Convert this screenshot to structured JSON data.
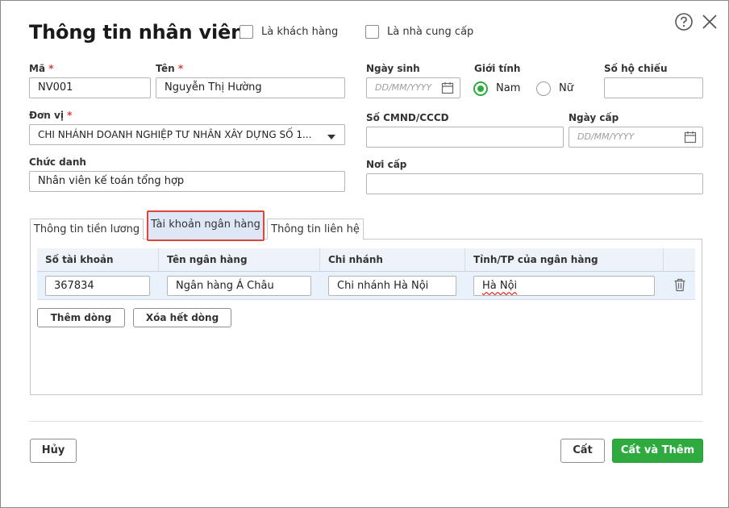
{
  "title": "Thông tin nhân viên",
  "flags": {
    "customer_label": "Là khách hàng",
    "supplier_label": "Là nhà cung cấp"
  },
  "fields": {
    "code": {
      "label": "Mã",
      "value": "NV001"
    },
    "name": {
      "label": "Tên",
      "value": "Nguyễn Thị Hường"
    },
    "unit": {
      "label": "Đơn vị",
      "value": "CHI NHÁNH DOANH NGHIỆP TƯ NHÂN XÂY DỰNG SỐ 1..."
    },
    "position": {
      "label": "Chức danh",
      "value": "Nhân viên kế toán tổng hợp"
    },
    "dob": {
      "label": "Ngày sinh",
      "placeholder": "DD/MM/YYYY"
    },
    "gender": {
      "label": "Giới tính",
      "male": "Nam",
      "female": "Nữ",
      "selected": "Nam"
    },
    "passport": {
      "label": "Số hộ chiếu",
      "value": ""
    },
    "id_number": {
      "label": "Số CMND/CCCD",
      "value": ""
    },
    "issue_date": {
      "label": "Ngày cấp",
      "placeholder": "DD/MM/YYYY"
    },
    "issue_place": {
      "label": "Nơi cấp",
      "value": ""
    }
  },
  "tabs": [
    {
      "label": "Thông tin tiền lương"
    },
    {
      "label": "Tài khoản ngân hàng"
    },
    {
      "label": "Thông tin liên hệ"
    }
  ],
  "bank_grid": {
    "headers": [
      "Số tài khoản",
      "Tên ngân hàng",
      "Chi nhánh",
      "Tỉnh/TP của ngân hàng"
    ],
    "rows": [
      {
        "account": "367834",
        "bank": "Ngân hàng Á Châu",
        "branch": "Chi nhánh Hà Nội",
        "province": "Hà Nội"
      }
    ],
    "add_row_label": "Thêm dòng",
    "clear_rows_label": "Xóa hết dòng"
  },
  "footer": {
    "cancel_label": "Hủy",
    "save_label": "Cất",
    "save_add_label": "Cất và Thêm"
  },
  "colors": {
    "accent": "#2eaa3f",
    "highlight": "#e0453d",
    "grid_header": "#eef3f9"
  },
  "icons": [
    "help-icon",
    "close-icon",
    "calendar-icon",
    "dropdown-arrow-icon",
    "trash-icon"
  ]
}
